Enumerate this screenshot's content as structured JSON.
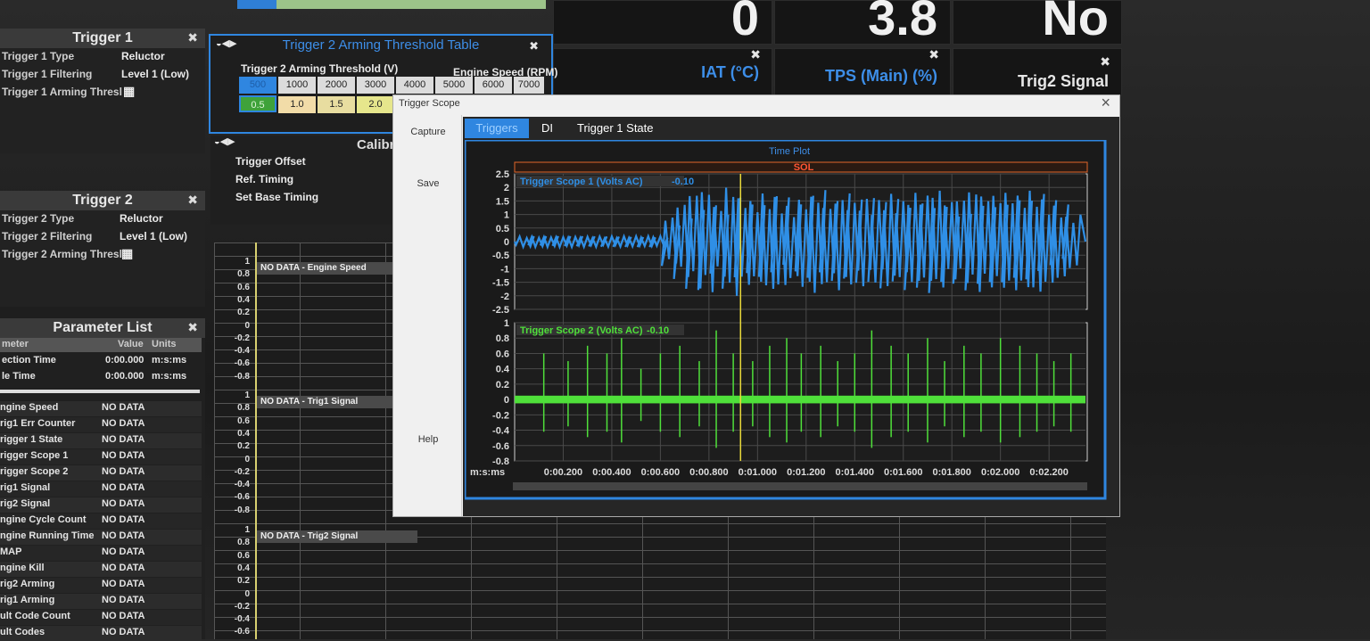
{
  "top_gauges": {
    "g1_value": "0",
    "g2_value": "3.8",
    "g3_value": "No"
  },
  "mid_gauges": [
    {
      "label": "IAT (°C)"
    },
    {
      "label": "TPS (Main) (%)"
    },
    {
      "label": "Trig2 Signal"
    }
  ],
  "trigger1": {
    "title": "Trigger 1",
    "rows": [
      {
        "label": "Trigger 1 Type",
        "value": "Reluctor"
      },
      {
        "label": "Trigger 1 Filtering",
        "value": "Level 1 (Low)"
      },
      {
        "label": "Trigger 1 Arming Thresl",
        "value": ""
      }
    ]
  },
  "trigger2": {
    "title": "Trigger 2",
    "rows": [
      {
        "label": "Trigger 2 Type",
        "value": "Reluctor"
      },
      {
        "label": "Trigger 2 Filtering",
        "value": "Level 1 (Low)"
      },
      {
        "label": "Trigger 2 Arming Thresl",
        "value": ""
      }
    ]
  },
  "arming_table": {
    "title": "Trigger 2 Arming Threshold Table",
    "row_header": "Trigger 2 Arming Threshold (V)",
    "col_header": "Engine Speed (RPM)",
    "rpm": [
      "1000",
      "2000",
      "3000",
      "4000",
      "5000",
      "6000",
      "7000"
    ],
    "first_rpm": "500",
    "first_value": "0.5",
    "values": [
      "1.0",
      "1.5",
      "2.0"
    ]
  },
  "calibration": {
    "title": "Calibra",
    "items": [
      "Trigger Offset",
      "Ref. Timing",
      "Set Base Timing"
    ]
  },
  "parameter_list": {
    "title": "Parameter List",
    "headers": [
      "meter",
      "Value",
      "Units"
    ],
    "top_rows": [
      {
        "name": "ection Time",
        "value": "0:00.000",
        "unit": "m:s:ms"
      },
      {
        "name": "le Time",
        "value": "0:00.000",
        "unit": "m:s:ms"
      }
    ],
    "rows": [
      {
        "name": "ngine Speed",
        "value": "NO DATA"
      },
      {
        "name": "rig1 Err Counter",
        "value": "NO DATA"
      },
      {
        "name": "rigger 1 State",
        "value": "NO DATA"
      },
      {
        "name": "rigger Scope 1",
        "value": "NO DATA"
      },
      {
        "name": "rigger Scope 2",
        "value": "NO DATA"
      },
      {
        "name": "rig1 Signal",
        "value": "NO DATA"
      },
      {
        "name": "rig2 Signal",
        "value": "NO DATA"
      },
      {
        "name": "ngine Cycle Count",
        "value": "NO DATA"
      },
      {
        "name": "ngine Running Time",
        "value": "NO DATA"
      },
      {
        "name": "MAP",
        "value": "NO DATA"
      },
      {
        "name": "ngine Kill",
        "value": "NO DATA"
      },
      {
        "name": "rig2 Arming",
        "value": "NO DATA"
      },
      {
        "name": "rig1 Arming",
        "value": "NO DATA"
      },
      {
        "name": "ult Code Count",
        "value": "NO DATA"
      },
      {
        "name": "ult Codes",
        "value": "NO DATA"
      }
    ]
  },
  "bg_plots": {
    "labels": [
      "NO DATA - Engine Speed",
      "NO DATA - Trig1 Signal",
      "NO DATA - Trig2 Signal"
    ],
    "ticks": [
      "1",
      "0.8",
      "0.6",
      "0.4",
      "0.2",
      "0",
      "-0.2",
      "-0.4",
      "-0.6",
      "-0.8"
    ]
  },
  "dialog": {
    "title": "Trigger Scope",
    "close": "×",
    "buttons": {
      "capture": "Capture",
      "save": "Save",
      "help": "Help"
    },
    "tabs": [
      "Triggers",
      "DI",
      "Trigger 1 State"
    ],
    "time_plot_label": "Time Plot",
    "sol_label": "SOL",
    "time_unit": "m:s:ms"
  },
  "chart_data": [
    {
      "type": "line",
      "title": "Trigger Scope 1 (Volts AC)",
      "cursor_value": "-0.10",
      "color": "#2f8fe6",
      "ylim": [
        -2.5,
        2.5
      ],
      "yticks": [
        "2.5",
        "2",
        "1.5",
        "1",
        "0.5",
        "0",
        "-0.5",
        "-1",
        "-1.5",
        "-2",
        "-2.5"
      ],
      "series": [
        {
          "name": "Trigger Scope 1 (Volts AC)",
          "x": [
            0.05,
            0.1,
            0.15,
            0.2,
            0.25,
            0.3,
            0.35,
            0.4,
            0.45,
            0.5,
            0.55,
            0.6,
            0.65,
            0.7,
            0.75,
            0.8,
            0.85,
            0.9,
            0.95,
            1.0,
            1.05,
            1.1,
            1.15,
            1.2,
            1.25,
            1.3,
            1.35,
            1.4,
            1.45,
            1.5,
            1.55,
            1.6,
            1.65,
            1.7,
            1.75,
            1.8,
            1.85,
            1.9,
            1.95,
            2.0,
            2.05,
            2.1,
            2.15,
            2.2,
            2.25,
            2.3
          ],
          "amp": [
            0.2,
            0.2,
            0.2,
            0.2,
            0.2,
            0.2,
            0.2,
            0.2,
            0.2,
            0.2,
            0.2,
            0.2,
            0.9,
            1.4,
            1.8,
            1.9,
            1.3,
            2.0,
            1.6,
            1.5,
            1.8,
            1.7,
            1.4,
            1.7,
            1.9,
            1.5,
            1.8,
            1.6,
            1.7,
            1.6,
            1.8,
            1.5,
            1.8,
            1.7,
            1.9,
            1.5,
            1.6,
            1.9,
            1.7,
            1.7,
            1.8,
            1.7,
            1.9,
            1.6,
            1.4,
            1.0
          ]
        }
      ]
    },
    {
      "type": "line",
      "title": "Trigger Scope 2 (Volts AC)",
      "cursor_value": "-0.10",
      "color": "#4fe03a",
      "ylim": [
        -0.8,
        1.0
      ],
      "yticks": [
        "1",
        "0.8",
        "0.6",
        "0.4",
        "0.2",
        "0",
        "-0.2",
        "-0.4",
        "-0.6",
        "-0.8"
      ],
      "series": [
        {
          "name": "Trigger Scope 2 (Volts AC)",
          "x": [
            0.12,
            0.22,
            0.3,
            0.38,
            0.44,
            0.52,
            0.6,
            0.68,
            0.76,
            0.83,
            0.9,
            0.98,
            1.05,
            1.12,
            1.18,
            1.26,
            1.33,
            1.4,
            1.47,
            1.55,
            1.62,
            1.7,
            1.77,
            1.85,
            1.92,
            2.0,
            2.08,
            2.15,
            2.22,
            2.29
          ],
          "spike": [
            0.6,
            0.5,
            0.7,
            0.6,
            0.8,
            0.4,
            0.6,
            0.7,
            0.5,
            0.9,
            0.6,
            0.5,
            0.7,
            0.8,
            0.6,
            0.7,
            0.5,
            0.6,
            0.9,
            0.7,
            0.6,
            0.8,
            0.5,
            0.7,
            0.6,
            0.8,
            0.7,
            0.6,
            0.5,
            0.6
          ]
        }
      ],
      "x_unit": "m:s:ms",
      "xticks": [
        "0:00.200",
        "0:00.400",
        "0:00.600",
        "0:00.800",
        "0:01.000",
        "0:01.200",
        "0:01.400",
        "0:01.600",
        "0:01.800",
        "0:02.000",
        "0:02.200"
      ]
    }
  ]
}
